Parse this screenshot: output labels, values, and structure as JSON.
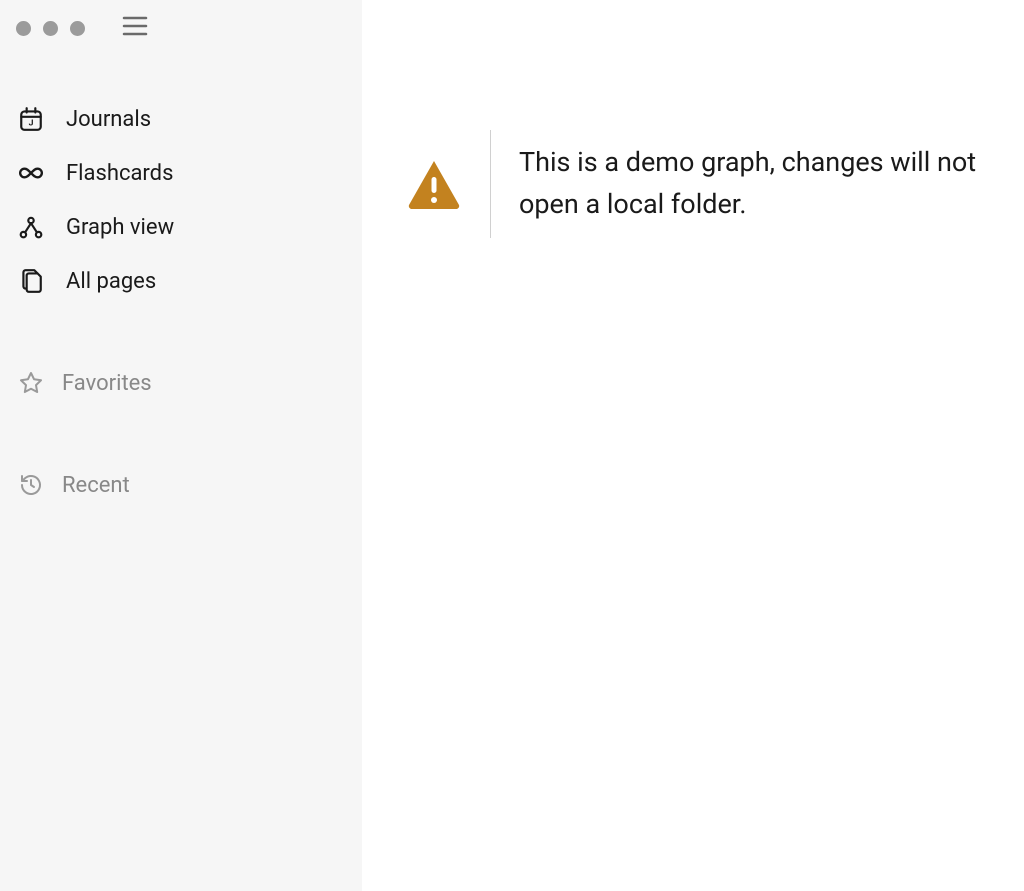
{
  "sidebar": {
    "nav_items": [
      {
        "label": "Journals",
        "icon": "calendar"
      },
      {
        "label": "Flashcards",
        "icon": "infinity"
      },
      {
        "label": "Graph view",
        "icon": "graph"
      },
      {
        "label": "All pages",
        "icon": "pages"
      }
    ],
    "favorites_label": "Favorites",
    "recent_label": "Recent"
  },
  "main": {
    "warning_line1": "This is a demo graph, changes will not",
    "warning_line2": "open a local folder."
  },
  "colors": {
    "warning_icon": "#c3821f",
    "sidebar_bg": "#f6f6f6",
    "text_primary": "#1a1a1a",
    "text_secondary": "#888888"
  }
}
